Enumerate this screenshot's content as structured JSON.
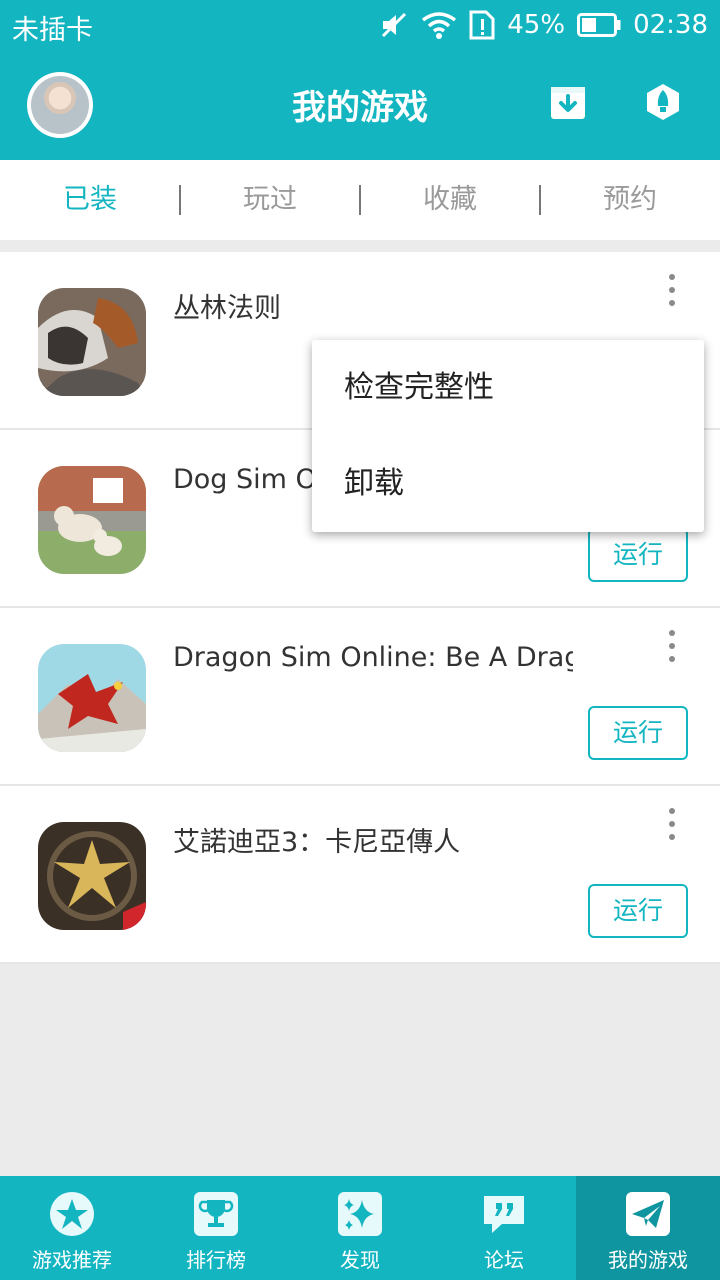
{
  "status_bar": {
    "carrier": "未插卡",
    "battery": "45%",
    "time": "02:38"
  },
  "header": {
    "title": "我的游戏",
    "icons": [
      "download-icon",
      "rocket-icon"
    ]
  },
  "tabs": [
    {
      "label": "已装",
      "active": true
    },
    {
      "label": "玩过",
      "active": false
    },
    {
      "label": "收藏",
      "active": false
    },
    {
      "label": "预约",
      "active": false
    }
  ],
  "games": [
    {
      "name": "丛林法则",
      "run_label": "",
      "has_run": false
    },
    {
      "name": "Dog Sim Or",
      "run_label": "运行",
      "has_run": true
    },
    {
      "name": "Dragon Sim Online: Be A Drag…",
      "run_label": "运行",
      "has_run": true
    },
    {
      "name": "艾諾迪亞3：卡尼亞傳人",
      "run_label": "运行",
      "has_run": true
    }
  ],
  "popup_menu": {
    "items": [
      "检查完整性",
      "卸载"
    ]
  },
  "bottom_nav": [
    {
      "label": "游戏推荐",
      "icon": "star-icon",
      "active": false
    },
    {
      "label": "排行榜",
      "icon": "trophy-icon",
      "active": false
    },
    {
      "label": "发现",
      "icon": "sparkle-icon",
      "active": false
    },
    {
      "label": "论坛",
      "icon": "quote-bubble-icon",
      "active": false
    },
    {
      "label": "我的游戏",
      "icon": "paper-plane-icon",
      "active": true
    }
  ],
  "colors": {
    "primary": "#13b5c1",
    "nav_active": "#0f959f",
    "background": "#ebebeb"
  }
}
